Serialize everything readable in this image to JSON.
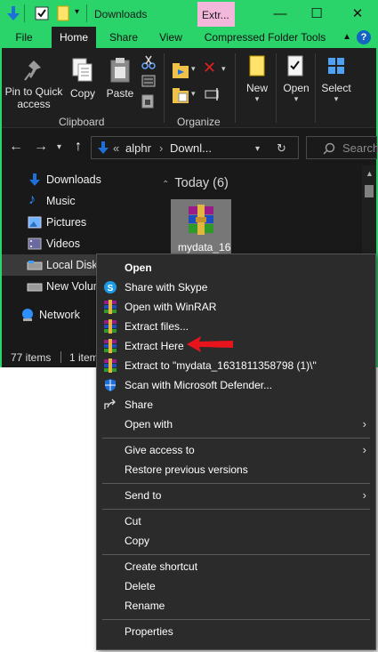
{
  "window": {
    "title": "Downloads",
    "contextual_tab": "Extr...",
    "accent_color": "#2bd36b",
    "controls": {
      "minimize": "—",
      "maximize": "☐",
      "close": "✕"
    }
  },
  "ribbon_tabs": [
    "File",
    "Home",
    "Share",
    "View",
    "Compressed Folder Tools"
  ],
  "ribbon": {
    "pin_label": "Pin to Quick access",
    "copy_label": "Copy",
    "paste_label": "Paste",
    "clipboard_group": "Clipboard",
    "organize_group": "Organize",
    "new_label": "New",
    "open_label": "Open",
    "select_label": "Select"
  },
  "address": {
    "prefix": "«",
    "path_1": "alphr",
    "sep": "›",
    "path_2": "Downl...",
    "search_placeholder": "Search"
  },
  "nav_pane": {
    "items": [
      {
        "label": "Downloads",
        "icon": "download-arrow-icon"
      },
      {
        "label": "Music",
        "icon": "music-note-icon"
      },
      {
        "label": "Pictures",
        "icon": "pictures-folder-icon"
      },
      {
        "label": "Videos",
        "icon": "videos-folder-icon"
      },
      {
        "label": "Local Disk",
        "icon": "drive-icon"
      },
      {
        "label": "New Volum",
        "icon": "drive-icon"
      },
      {
        "label": "Network",
        "icon": "network-icon"
      }
    ]
  },
  "content": {
    "group_header": "Today (6)",
    "file_name": "mydata_16"
  },
  "status": {
    "items_count": "77 items",
    "selected": "1 item"
  },
  "context_menu": {
    "open": "Open",
    "share_skype": "Share with Skype",
    "open_winrar": "Open with WinRAR",
    "extract_files": "Extract files...",
    "extract_here": "Extract Here",
    "extract_to": "Extract to \"mydata_1631811358798 (1)\\\"",
    "defender": "Scan with Microsoft Defender...",
    "share": "Share",
    "open_with": "Open with",
    "give_access": "Give access to",
    "restore": "Restore previous versions",
    "send_to": "Send to",
    "cut": "Cut",
    "copy": "Copy",
    "create_shortcut": "Create shortcut",
    "delete": "Delete",
    "rename": "Rename",
    "properties": "Properties"
  },
  "annotation": {
    "arrow_color": "#e8141b"
  }
}
